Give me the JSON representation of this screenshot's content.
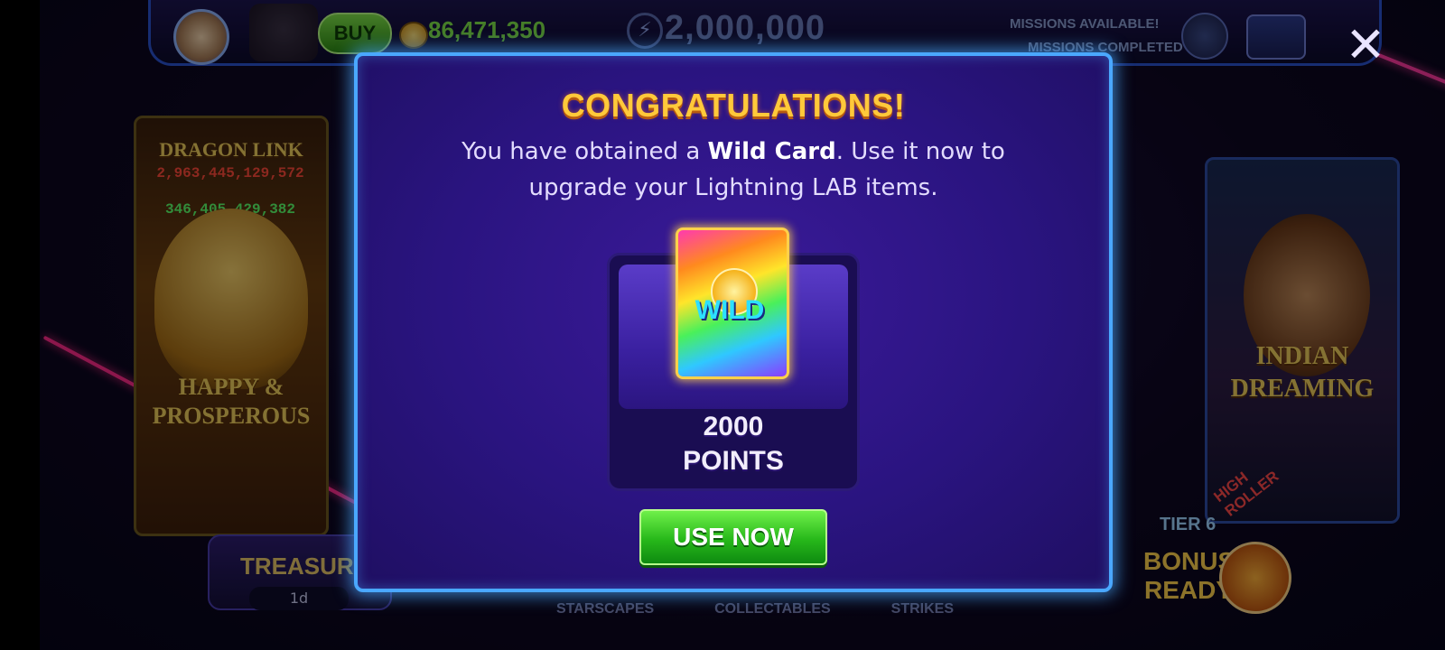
{
  "header": {
    "buy_label": "BUY",
    "coins": "86,471,350",
    "jackpot": "2,000,000",
    "missions_available": "MISSIONS AVAILABLE!",
    "missions_completed": "MISSIONS COMPLETED"
  },
  "slots": {
    "left": {
      "title": "DRAGON LINK",
      "jackpot_1": "2,963,445,129,572",
      "jackpot_2": "346,405,429,382",
      "subtitle": "HAPPY & PROSPEROUS"
    },
    "right": {
      "title": "INDIAN DREAMING",
      "badge": "HIGH ROLLER"
    }
  },
  "treasure": {
    "label": "TREASURE",
    "timer": "1d"
  },
  "tier": {
    "label": "TIER 6",
    "bonus": "BONUS READY"
  },
  "bottom_tabs": [
    "STARSCAPES",
    "COLLECTABLES",
    "STRIKES"
  ],
  "modal": {
    "title": "CONGRATULATIONS!",
    "message_pre": "You have obtained a ",
    "message_bold": "Wild Card",
    "message_post": ". Use it now to upgrade your Lightning LAB items.",
    "card_label": "WILD",
    "points_value": "2000",
    "points_unit": "POINTS",
    "cta_label": "USE NOW"
  },
  "colors": {
    "modal_border": "#4aa8ff",
    "title_gold": "#ffc93a",
    "cta_green": "#27b81a",
    "coins_green": "#7fe34a"
  },
  "icons": {
    "close": "close-icon",
    "coin": "coin-icon",
    "lightning": "lightning-icon",
    "mail": "mail-icon"
  }
}
